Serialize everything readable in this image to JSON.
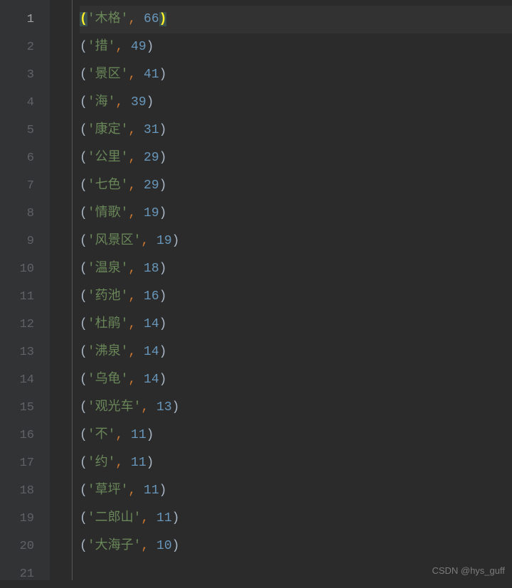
{
  "active_line": 1,
  "lines": [
    {
      "num": 1,
      "word": "木格",
      "count": 66,
      "highlighted": true
    },
    {
      "num": 2,
      "word": "措",
      "count": 49,
      "highlighted": false
    },
    {
      "num": 3,
      "word": "景区",
      "count": 41,
      "highlighted": false
    },
    {
      "num": 4,
      "word": "海",
      "count": 39,
      "highlighted": false
    },
    {
      "num": 5,
      "word": "康定",
      "count": 31,
      "highlighted": false
    },
    {
      "num": 6,
      "word": "公里",
      "count": 29,
      "highlighted": false
    },
    {
      "num": 7,
      "word": "七色",
      "count": 29,
      "highlighted": false
    },
    {
      "num": 8,
      "word": "情歌",
      "count": 19,
      "highlighted": false
    },
    {
      "num": 9,
      "word": "风景区",
      "count": 19,
      "highlighted": false
    },
    {
      "num": 10,
      "word": "温泉",
      "count": 18,
      "highlighted": false
    },
    {
      "num": 11,
      "word": "药池",
      "count": 16,
      "highlighted": false
    },
    {
      "num": 12,
      "word": "杜鹃",
      "count": 14,
      "highlighted": false
    },
    {
      "num": 13,
      "word": "沸泉",
      "count": 14,
      "highlighted": false
    },
    {
      "num": 14,
      "word": "乌龟",
      "count": 14,
      "highlighted": false
    },
    {
      "num": 15,
      "word": "观光车",
      "count": 13,
      "highlighted": false
    },
    {
      "num": 16,
      "word": "不",
      "count": 11,
      "highlighted": false
    },
    {
      "num": 17,
      "word": "约",
      "count": 11,
      "highlighted": false
    },
    {
      "num": 18,
      "word": "草坪",
      "count": 11,
      "highlighted": false
    },
    {
      "num": 19,
      "word": "二郎山",
      "count": 11,
      "highlighted": false
    },
    {
      "num": 20,
      "word": "大海子",
      "count": 10,
      "highlighted": false
    },
    {
      "num": 21,
      "word": "",
      "count": null,
      "highlighted": false
    }
  ],
  "watermark": "CSDN @hys_guff"
}
